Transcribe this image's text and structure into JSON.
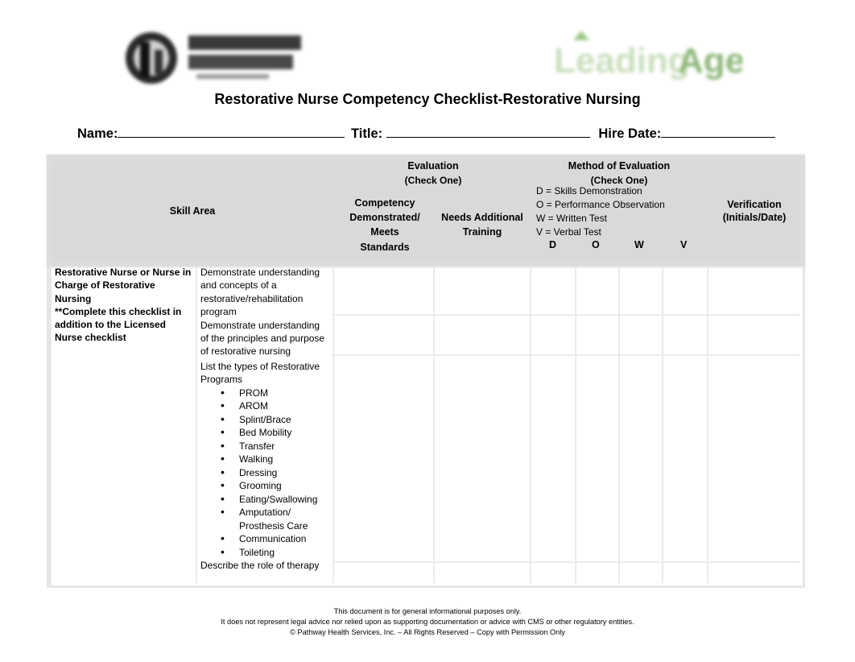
{
  "logos": {
    "left": {
      "name": "Pathway Health",
      "line1": "PATHWAY",
      "line2": "HEALTH"
    },
    "right": {
      "name": "LeadingAge",
      "text": "LeadingAge"
    }
  },
  "title": "Restorative Nurse Competency Checklist-Restorative Nursing",
  "fields": {
    "name_label": "Name:",
    "title_label": "Title:",
    "hire_date_label": "Hire Date:"
  },
  "table": {
    "headers": {
      "skill_area": "Skill Area",
      "evaluation": "Evaluation",
      "evaluation_sub": "(Check One)",
      "competency": [
        "Competency",
        "Demonstrated/",
        "Meets",
        "Standards"
      ],
      "needs_training": [
        "Needs Additional",
        "Training"
      ],
      "method": "Method of Evaluation",
      "method_sub": "(Check One)",
      "method_legend": [
        "D = Skills Demonstration",
        "O = Performance Observation",
        "W = Written Test",
        "V = Verbal Test"
      ],
      "method_codes": [
        "D",
        "O",
        "W",
        "V"
      ],
      "verification": [
        "Verification",
        "(Initials/Date)"
      ]
    },
    "skill_area_text": [
      "Restorative Nurse or Nurse in",
      "Charge of Restorative Nursing",
      "**Complete this checklist in",
      "addition to the Licensed",
      "Nurse checklist"
    ],
    "rows": [
      {
        "lines": [
          "Demonstrate understanding",
          "and concepts of a",
          "restorative/rehabilitation",
          "program"
        ]
      },
      {
        "lines": [
          "Demonstrate understanding",
          "of the principles and purpose",
          "of restorative nursing"
        ]
      },
      {
        "lines": [
          "List the types of Restorative",
          "Programs"
        ],
        "bullets": [
          "PROM",
          "AROM",
          "Splint/Brace",
          "Bed Mobility",
          "Transfer",
          "Walking",
          "Dressing",
          "Grooming",
          "Eating/Swallowing",
          "Amputation/ Prosthesis Care",
          "Communication",
          "Toileting"
        ]
      },
      {
        "lines": [
          "Describe the role of therapy"
        ]
      }
    ]
  },
  "footer": {
    "line1": "This document is for general informational purposes only.",
    "line2": "It does not represent legal advice nor relied upon as supporting documentation or advice with CMS or other regulatory entities.",
    "line3": "© Pathway Health Services, Inc. – All Rights Reserved – Copy with Permission Only"
  }
}
